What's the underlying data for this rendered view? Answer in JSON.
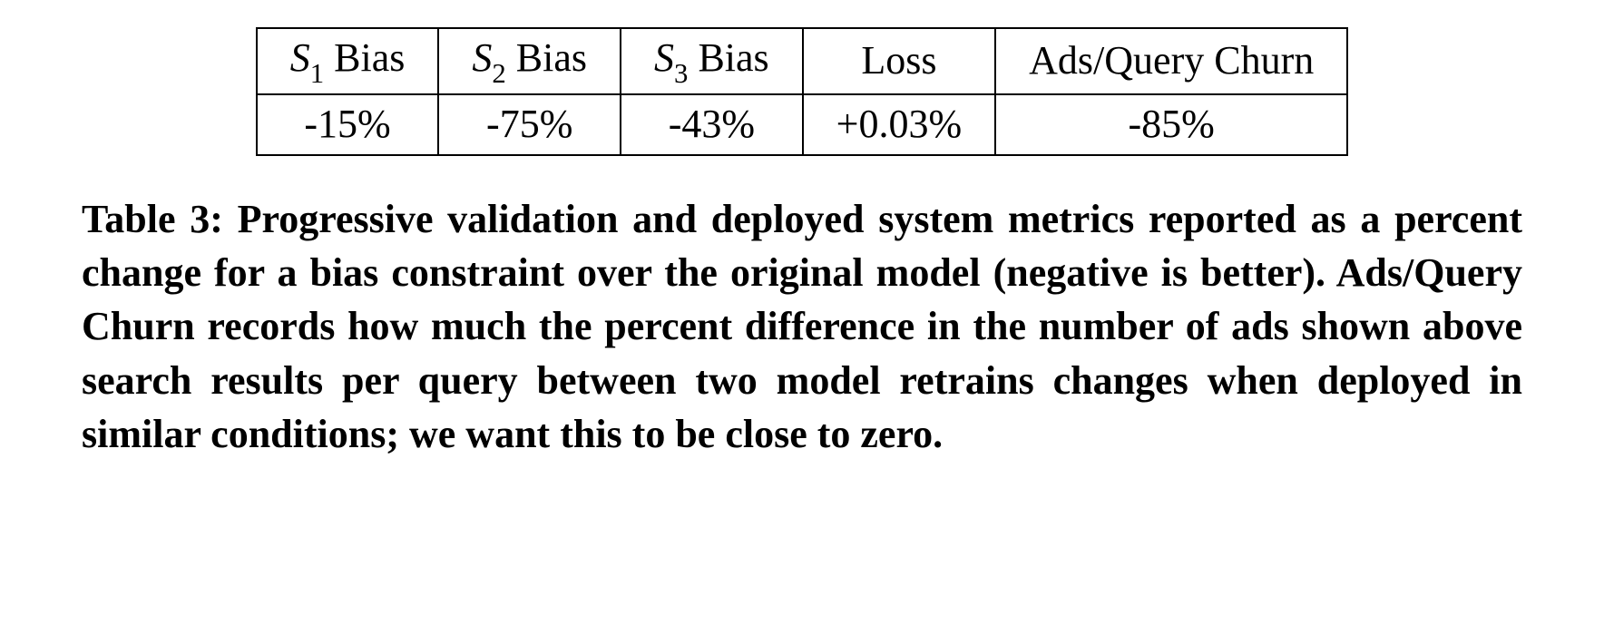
{
  "chart_data": {
    "type": "table",
    "title": "Table 3",
    "columns": [
      "S1 Bias",
      "S2 Bias",
      "S3 Bias",
      "Loss",
      "Ads/Query Churn"
    ],
    "rows": [
      [
        "-15%",
        "-75%",
        "-43%",
        "+0.03%",
        "-85%"
      ]
    ]
  },
  "table": {
    "headers": {
      "h0_prefix": "S",
      "h0_sub": "1",
      "h0_suffix": " Bias",
      "h1_prefix": "S",
      "h1_sub": "2",
      "h1_suffix": " Bias",
      "h2_prefix": "S",
      "h2_sub": "3",
      "h2_suffix": " Bias",
      "h3": "Loss",
      "h4": "Ads/Query Churn"
    },
    "row0": {
      "c0": "-15%",
      "c1": "-75%",
      "c2": "-43%",
      "c3": "+0.03%",
      "c4": "-85%"
    }
  },
  "caption": {
    "label": "Table 3:",
    "text": " Progressive validation and deployed system metrics reported as a percent change for a bias constraint over the original model (negative is better). Ads/Query Churn records how much the percent difference in the number of ads shown above search results per query between two model retrains changes when deployed in similar conditions; we want this to be close to zero."
  }
}
